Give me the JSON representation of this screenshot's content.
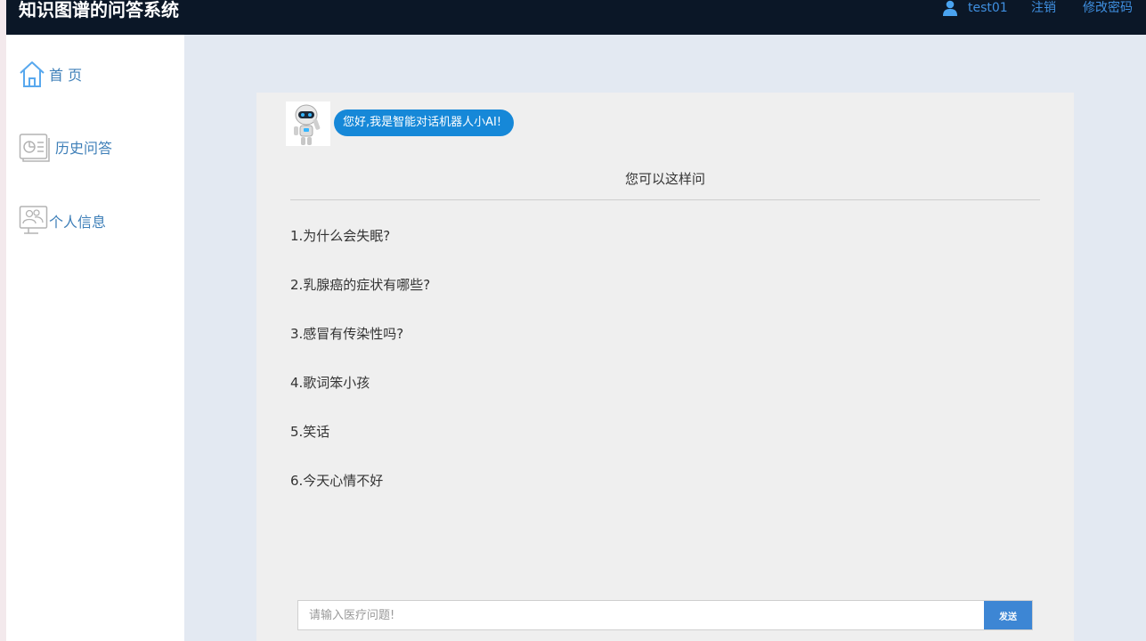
{
  "app": {
    "title": "知识图谱的问答系统"
  },
  "header": {
    "username": "test01",
    "logout_label": "注销",
    "change_password_label": "修改密码"
  },
  "sidebar": {
    "items": [
      {
        "label": "首 页",
        "icon": "home-icon"
      },
      {
        "label": "历史问答",
        "icon": "history-icon"
      },
      {
        "label": "个人信息",
        "icon": "profile-icon"
      }
    ]
  },
  "chat": {
    "greeting": "您好,我是智能对话机器人小AI!",
    "suggest_title": "您可以这样问",
    "questions": [
      "1.为什么会失眠?",
      "2.乳腺癌的症状有哪些?",
      "3.感冒有传染性吗?",
      "4.歌词笨小孩",
      "5.笑话",
      "6.今天心情不好"
    ],
    "input_placeholder": "请输入医疗问题!",
    "send_label": "发送"
  },
  "colors": {
    "header_bg": "#0b1727",
    "accent": "#1688d8",
    "nav_text": "#3e7fb8",
    "main_bg": "#e3e9f2",
    "panel_bg": "#efefef"
  }
}
